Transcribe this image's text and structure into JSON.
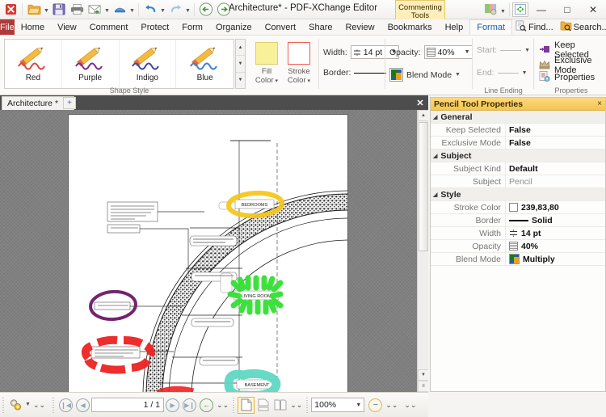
{
  "window": {
    "title": "Architecture* - PDF-XChange Editor",
    "contextual_tab": "Commenting Tools",
    "minimize": "—",
    "maximize": "□",
    "close": "✕"
  },
  "quick_access": [
    {
      "name": "app-logo-icon",
      "label": ""
    },
    {
      "name": "open-icon",
      "label": ""
    },
    {
      "name": "save-icon",
      "label": ""
    },
    {
      "name": "print-icon",
      "label": ""
    },
    {
      "name": "email-icon",
      "label": ""
    },
    {
      "name": "scan-icon",
      "label": ""
    },
    {
      "name": "undo-icon",
      "label": ""
    },
    {
      "name": "redo-icon",
      "label": ""
    },
    {
      "name": "back-icon",
      "label": ""
    },
    {
      "name": "forward-icon",
      "label": ""
    }
  ],
  "menu": {
    "file": "File",
    "items": [
      "Home",
      "View",
      "Comment",
      "Protect",
      "Form",
      "Organize",
      "Convert",
      "Share",
      "Review",
      "Bookmarks",
      "Help",
      "Format"
    ],
    "active": "Format",
    "find": "Find...",
    "search": "Search...",
    "collapse": "∧"
  },
  "ribbon": {
    "shape_style": {
      "group_label": "Shape Style",
      "items": [
        {
          "label": "Red",
          "color": "#e0453e"
        },
        {
          "label": "Purple",
          "color": "#7a2d8f"
        },
        {
          "label": "Indigo",
          "color": "#3a49a4"
        },
        {
          "label": "Blue",
          "color": "#3f7fd4"
        }
      ]
    },
    "fill_color": {
      "label_line1": "Fill",
      "label_line2": "Color",
      "swatch": "#f9f09a"
    },
    "stroke_color": {
      "label_line1": "Stroke",
      "label_line2": "Color",
      "swatch": "#ffffff",
      "border": "#ef5e55"
    },
    "width": {
      "label": "Width:",
      "value": "14 pt"
    },
    "border": {
      "label": "Border:"
    },
    "opacity": {
      "label": "Opacity:",
      "value": "40%"
    },
    "blend_mode": {
      "label": "Blend Mode"
    },
    "line_ending": {
      "group_label": "Line Ending",
      "start_label": "Start:",
      "end_label": "End:"
    },
    "properties_group": {
      "group_label": "Properties",
      "keep_selected": "Keep Selected",
      "exclusive_mode": "Exclusive Mode",
      "properties": "Properties"
    }
  },
  "doc_tabs": {
    "tab_label": "Architecture *",
    "tab_close": "✕",
    "add_tab": "+",
    "pane_close": "✕"
  },
  "document": {
    "annotations": [
      {
        "name": "bedrooms-label",
        "text": "BEDROOMS",
        "ink_color": "#f5c518"
      },
      {
        "name": "living-room-label",
        "text": "LIVING ROOM",
        "ink_color": "#33e033"
      },
      {
        "name": "basement-label",
        "text": "BASEMENT",
        "ink_color": "#5fd8c4"
      },
      {
        "name": "purple-callout",
        "text": "FINISH GR. EL.",
        "ink_color": "#73246e"
      },
      {
        "name": "red-callout",
        "text": "1-1/2 INCH CAP RAIL, CURVED LENGTHS, CUT AND FIT, BOLT TO SHAFT INTO 2X2X1 CORBEL.",
        "ink_color": "#ee2222"
      }
    ]
  },
  "properties_pane": {
    "title": "Pencil Tool Properties",
    "close": "×",
    "groups": [
      {
        "name": "General",
        "rows": [
          {
            "key": "Keep Selected",
            "value": "False",
            "kind": "text"
          },
          {
            "key": "Exclusive Mode",
            "value": "False",
            "kind": "text"
          }
        ]
      },
      {
        "name": "Subject",
        "rows": [
          {
            "key": "Subject Kind",
            "value": "Default",
            "kind": "text"
          },
          {
            "key": "Subject",
            "value": "Pencil",
            "kind": "dim"
          }
        ]
      },
      {
        "name": "Style",
        "rows": [
          {
            "key": "Stroke Color",
            "value": "239,83,80",
            "kind": "swatch",
            "swatch": "#ffffff",
            "swatch_border": "#ef5e55"
          },
          {
            "key": "Border",
            "value": "Solid",
            "kind": "line"
          },
          {
            "key": "Width",
            "value": "14 pt",
            "kind": "width"
          },
          {
            "key": "Opacity",
            "value": "40%",
            "kind": "opacity"
          },
          {
            "key": "Blend Mode",
            "value": "Multiply",
            "kind": "blend"
          }
        ]
      }
    ]
  },
  "status_bar": {
    "page_value": "1 / 1",
    "zoom_value": "100%",
    "first_page": "❘◀",
    "prev_page": "◀",
    "next_page": "▶",
    "last_page": "▶❘",
    "back": "←",
    "expand": "»"
  }
}
